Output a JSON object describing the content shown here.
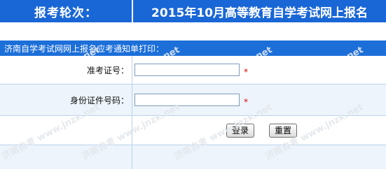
{
  "header": {
    "left_title": "报考轮次：",
    "right_title": "2015年10月高等教育自学考试网上报名"
  },
  "section": {
    "title": "济南自学考试网网上报名应考通知单打印："
  },
  "form": {
    "exam_id_label": "准考证号：",
    "exam_id_value": "",
    "id_card_label": "身份证件号码：",
    "id_card_value": "",
    "required_mark": "*",
    "login_button": "登录",
    "reset_button": "重置"
  },
  "watermark": {
    "text": "济南自考 www.jnzk.net"
  },
  "colors": {
    "header_bg": "#1966d6",
    "section_bg": "#1c6fd9",
    "alt_row_bg": "#edf4fb",
    "required": "#e60000"
  }
}
